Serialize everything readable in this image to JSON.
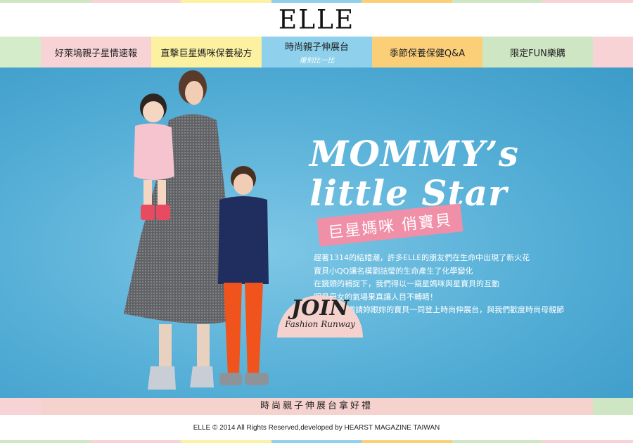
{
  "brand": {
    "logo": "ELLE"
  },
  "nav": {
    "items": [
      {
        "label": "好萊塢親子星情速報",
        "sub": "",
        "color": "#f7d3d6"
      },
      {
        "label": "直擊巨星媽咪保養秘方",
        "sub": "",
        "color": "#fbf1a0"
      },
      {
        "label": "時尚親子伸展台",
        "sub": "複刻比一比",
        "color": "#8fd0ec"
      },
      {
        "label": "季節保養保健Q&A",
        "sub": "",
        "color": "#fbcf78"
      },
      {
        "label": "限定FUN樂購",
        "sub": "",
        "color": "#cfe6c4"
      }
    ],
    "edge_left_color": "#d5eccb",
    "edge_right_color": "#f7d3d6"
  },
  "hero": {
    "headline_1": "MOMMY’s",
    "headline_2": "little Star",
    "tagline": "巨星媽咪 俏寶貝",
    "copy": [
      "趕著1314的結婚潮，許多ELLE的朋友們在生命中出現了新火花",
      "寶貝小QQ讓名模劉詰瑩的生命產生了化學變化",
      "在鏡頭的補捉下，我們得以一窺星媽咪與星寶貝的互動",
      "明星母女的氣場果真讓人目不轉睛！",
      "現在ELLE邀請妳跟妳的寶貝一同登上時尚伸展台，與我們歡度時尚母親節"
    ],
    "bg_color": "#54aed6"
  },
  "join": {
    "big": "JOIN",
    "small": "Fashion Runway"
  },
  "cta": {
    "label": "時尚親子伸展台拿好禮"
  },
  "footer": {
    "text": "ELLE © 2014 All Rights Reserved,developed by HEARST MAGAZINE TAIWAN"
  }
}
